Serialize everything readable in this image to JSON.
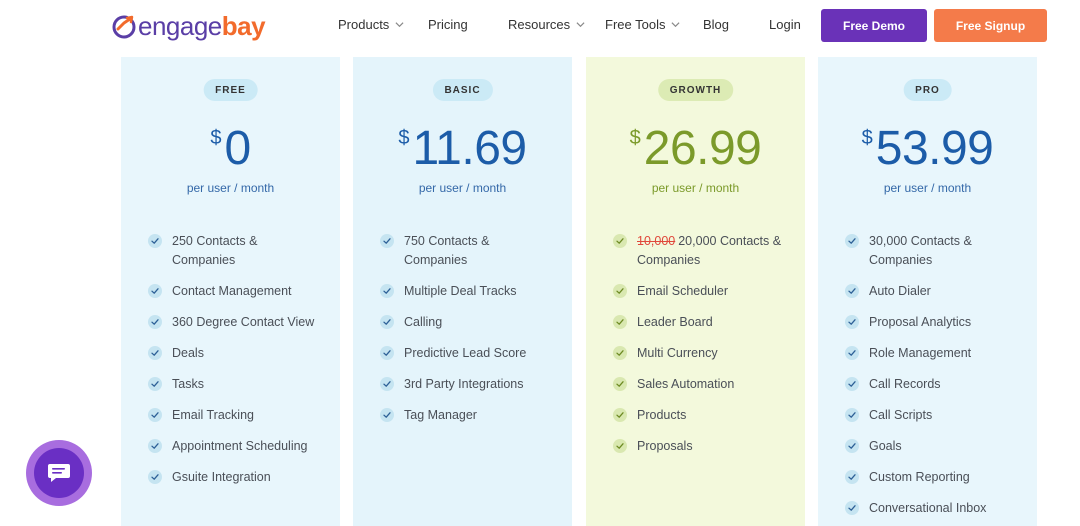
{
  "brand": {
    "part1": "engage",
    "part2": "bay"
  },
  "nav": [
    {
      "label": "Products",
      "dropdown": true
    },
    {
      "label": "Pricing",
      "dropdown": false
    },
    {
      "label": "Resources",
      "dropdown": true
    },
    {
      "label": "Free Tools",
      "dropdown": true
    },
    {
      "label": "Blog",
      "dropdown": false
    },
    {
      "label": "Login",
      "dropdown": false
    }
  ],
  "buttons": {
    "demo": "Free Demo",
    "signup": "Free Signup"
  },
  "colors": {
    "brand_purple": "#6a32b8",
    "brand_orange": "#f47b4a",
    "price_blue": "#1c5ca8",
    "price_green": "#7b9a2a"
  },
  "plans": [
    {
      "id": "free",
      "badge": "FREE",
      "currency": "$",
      "price": "0",
      "period": "per user / month",
      "features": [
        {
          "text": "250 Contacts & Companies"
        },
        {
          "text": "Contact Management"
        },
        {
          "text": "360 Degree Contact View"
        },
        {
          "text": "Deals"
        },
        {
          "text": "Tasks"
        },
        {
          "text": "Email Tracking"
        },
        {
          "text": "Appointment Scheduling"
        },
        {
          "text": "Gsuite Integration"
        }
      ]
    },
    {
      "id": "basic",
      "badge": "BASIC",
      "currency": "$",
      "price": "11.69",
      "period": "per user / month",
      "features": [
        {
          "text": "750 Contacts & Companies"
        },
        {
          "text": "Multiple Deal Tracks"
        },
        {
          "text": "Calling"
        },
        {
          "text": "Predictive Lead Score"
        },
        {
          "text": "3rd Party Integrations"
        },
        {
          "text": "Tag Manager"
        }
      ]
    },
    {
      "id": "growth",
      "badge": "GROWTH",
      "currency": "$",
      "price": "26.99",
      "period": "per user / month",
      "features": [
        {
          "strike": "10,000",
          "text": "20,000 Contacts & Companies"
        },
        {
          "text": "Email Scheduler"
        },
        {
          "text": "Leader Board"
        },
        {
          "text": "Multi Currency"
        },
        {
          "text": "Sales Automation"
        },
        {
          "text": "Products"
        },
        {
          "text": "Proposals"
        }
      ]
    },
    {
      "id": "pro",
      "badge": "PRO",
      "currency": "$",
      "price": "53.99",
      "period": "per user / month",
      "features": [
        {
          "text": "30,000 Contacts & Companies"
        },
        {
          "text": "Auto Dialer"
        },
        {
          "text": "Proposal Analytics"
        },
        {
          "text": "Role Management"
        },
        {
          "text": "Call Records"
        },
        {
          "text": "Call Scripts"
        },
        {
          "text": "Goals"
        },
        {
          "text": "Custom Reporting"
        },
        {
          "text": "Conversational Inbox"
        }
      ]
    }
  ],
  "icons": {
    "logo": "engagebay-logo-icon",
    "check": "check-icon",
    "chevron": "chevron-down-icon",
    "chat": "chat-icon"
  }
}
